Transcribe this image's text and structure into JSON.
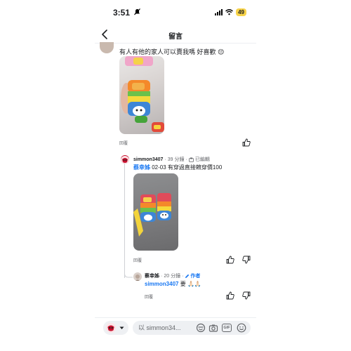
{
  "status_bar": {
    "time": "3:51",
    "battery": "49"
  },
  "nav": {
    "title": "留言"
  },
  "comment": {
    "text": "有人有他的家人可以賣我嗎 好喜歡",
    "emoji": "😌",
    "reply_label": "回覆"
  },
  "reply1": {
    "name": "simmon3407",
    "time": "39 分鐘",
    "edited": "已編輯",
    "mention": "蔡幸姊",
    "text": "02-03 有穿過直接賴穿價100",
    "reply_label": "回覆"
  },
  "reply2": {
    "name": "蔡幸姊",
    "time": "20 分鐘",
    "author_badge": "作者",
    "mention": "simmon3407",
    "text": "要",
    "emoji": "🙏🏻🙏🏻",
    "reply_label": "回覆"
  },
  "composer": {
    "placeholder": "以 simmon34..."
  },
  "colors": {
    "accent": "#1877f2",
    "muted": "#65676b",
    "battery": "#f7d34a"
  },
  "icons": [
    "silent-bell-icon",
    "signal-icon",
    "wifi-icon",
    "back-chevron-icon",
    "like-icon",
    "dislike-icon",
    "pencil-icon",
    "edit-icon",
    "emoji-sticker-icon",
    "camera-icon",
    "gif-icon",
    "smiley-icon",
    "chevron-down-icon"
  ]
}
